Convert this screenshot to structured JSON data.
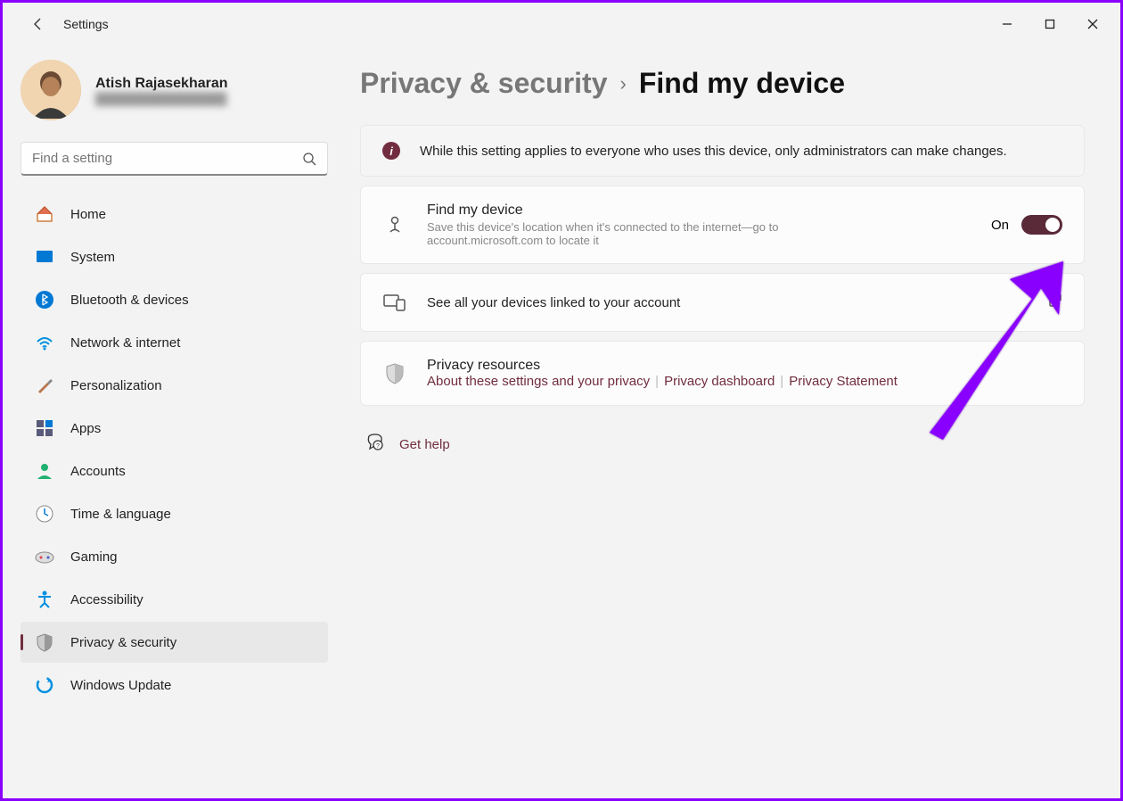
{
  "window": {
    "title": "Settings"
  },
  "profile": {
    "name": "Atish Rajasekharan",
    "email": "████████████████"
  },
  "search": {
    "placeholder": "Find a setting"
  },
  "nav": [
    {
      "id": "home",
      "label": "Home"
    },
    {
      "id": "system",
      "label": "System"
    },
    {
      "id": "bluetooth",
      "label": "Bluetooth & devices"
    },
    {
      "id": "network",
      "label": "Network & internet"
    },
    {
      "id": "personalization",
      "label": "Personalization"
    },
    {
      "id": "apps",
      "label": "Apps"
    },
    {
      "id": "accounts",
      "label": "Accounts"
    },
    {
      "id": "time",
      "label": "Time & language"
    },
    {
      "id": "gaming",
      "label": "Gaming"
    },
    {
      "id": "accessibility",
      "label": "Accessibility"
    },
    {
      "id": "privacy",
      "label": "Privacy & security"
    },
    {
      "id": "update",
      "label": "Windows Update"
    }
  ],
  "breadcrumb": {
    "parent": "Privacy & security",
    "current": "Find my device"
  },
  "info_banner": "While this setting applies to everyone who uses this device, only administrators can make changes.",
  "find_device": {
    "title": "Find my device",
    "subtitle": "Save this device's location when it's connected to the internet—go to account.microsoft.com to locate it",
    "state": "On"
  },
  "linked_devices": {
    "text": "See all your devices linked to your account"
  },
  "privacy_resources": {
    "title": "Privacy resources",
    "links": {
      "about": "About these settings and your privacy",
      "dashboard": "Privacy dashboard",
      "statement": "Privacy Statement"
    }
  },
  "help": {
    "label": "Get help"
  },
  "colors": {
    "accent": "#712d3f",
    "annotation": "#8a00ff"
  }
}
